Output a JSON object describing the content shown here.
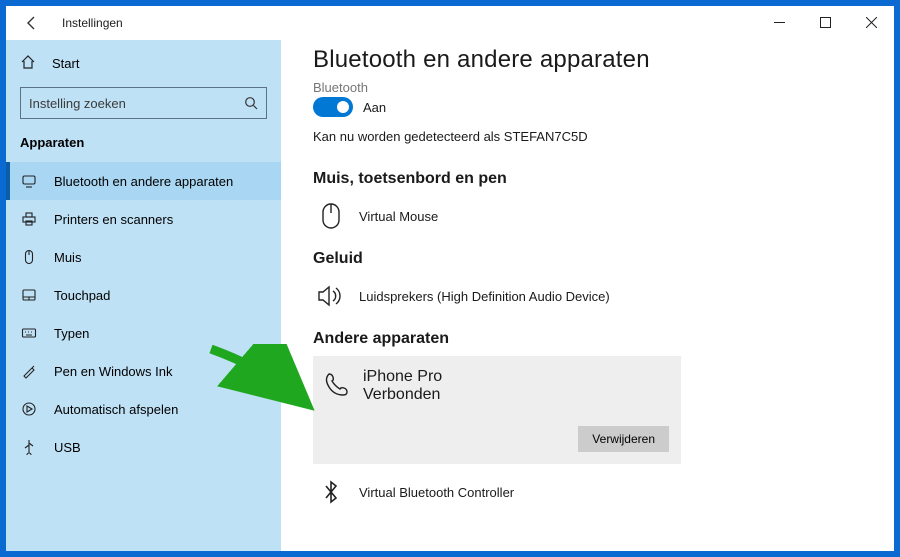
{
  "titlebar": {
    "title": "Instellingen"
  },
  "sidebar": {
    "home": "Start",
    "search_placeholder": "Instelling zoeken",
    "section": "Apparaten",
    "items": [
      {
        "label": "Bluetooth en andere apparaten"
      },
      {
        "label": "Printers en scanners"
      },
      {
        "label": "Muis"
      },
      {
        "label": "Touchpad"
      },
      {
        "label": "Typen"
      },
      {
        "label": "Pen en Windows Ink"
      },
      {
        "label": "Automatisch afspelen"
      },
      {
        "label": "USB"
      }
    ]
  },
  "content": {
    "page_title": "Bluetooth en andere apparaten",
    "cut_word": "Bluetooth",
    "toggle_label": "Aan",
    "detect_line": "Kan nu worden gedetecteerd als STEFAN7C5D",
    "section_mouse": "Muis, toetsenbord en pen",
    "mouse_device": "Virtual Mouse",
    "section_audio": "Geluid",
    "audio_device": "Luidsprekers (High Definition Audio Device)",
    "section_other": "Andere apparaten",
    "other_device_name": "iPhone Pro",
    "other_device_status": "Verbonden",
    "remove_btn": "Verwijderen",
    "bt_controller": "Virtual Bluetooth Controller"
  }
}
